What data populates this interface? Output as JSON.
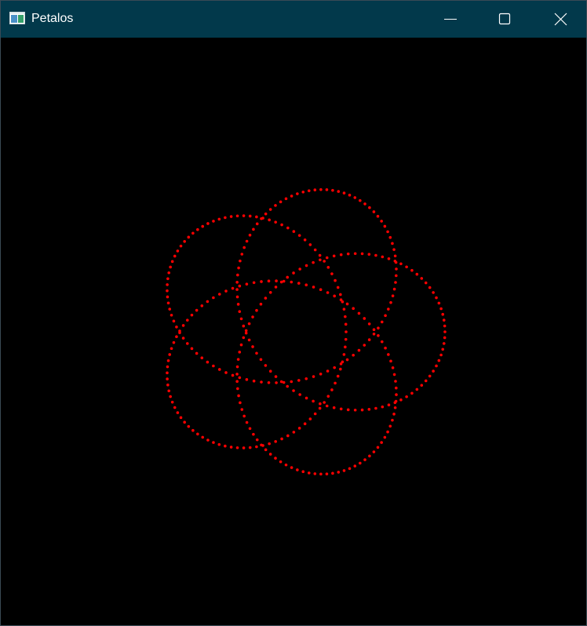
{
  "window": {
    "title": "Petalos",
    "app_icon": "window-app-icon",
    "controls": {
      "minimize_icon": "minimize-icon",
      "maximize_icon": "maximize-icon",
      "close_icon": "close-icon"
    }
  },
  "canvas": {
    "background_color": "#000000",
    "point_color": "#ff0000",
    "curve_type": "5-petal loop curve (dotted)",
    "petal_count": 5
  },
  "colors": {
    "titlebar": "#02394b",
    "title_text": "#ffffff"
  }
}
